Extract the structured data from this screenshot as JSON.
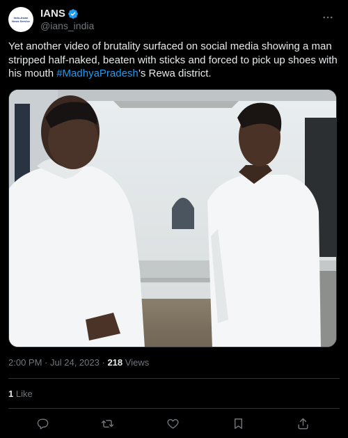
{
  "author": {
    "display_name": "IANS",
    "handle": "@ians_india",
    "avatar_text": "Indo-Asian News Service",
    "verified_icon": "verified-badge-icon"
  },
  "tweet": {
    "text_before": "Yet another video of brutality surfaced on social media showing a man stripped half-naked, beaten with sticks and forced to pick up shoes with his mouth ",
    "hashtag": "#MadhyaPradesh",
    "text_after": "’s Rewa district."
  },
  "meta": {
    "time": "2:00 PM",
    "separator": "·",
    "date": "Jul 24, 2023",
    "views_count": "218",
    "views_label": "Views"
  },
  "engagement": {
    "likes_count": "1",
    "likes_label": "Like"
  },
  "actions": {
    "reply_icon": "reply-icon",
    "repost_icon": "repost-icon",
    "like_icon": "heart-icon",
    "bookmark_icon": "bookmark-icon",
    "share_icon": "share-icon"
  },
  "colors": {
    "background": "#000000",
    "text": "#e7e9ea",
    "muted": "#71767b",
    "accent": "#1d9bf0",
    "divider": "#2f3336"
  }
}
